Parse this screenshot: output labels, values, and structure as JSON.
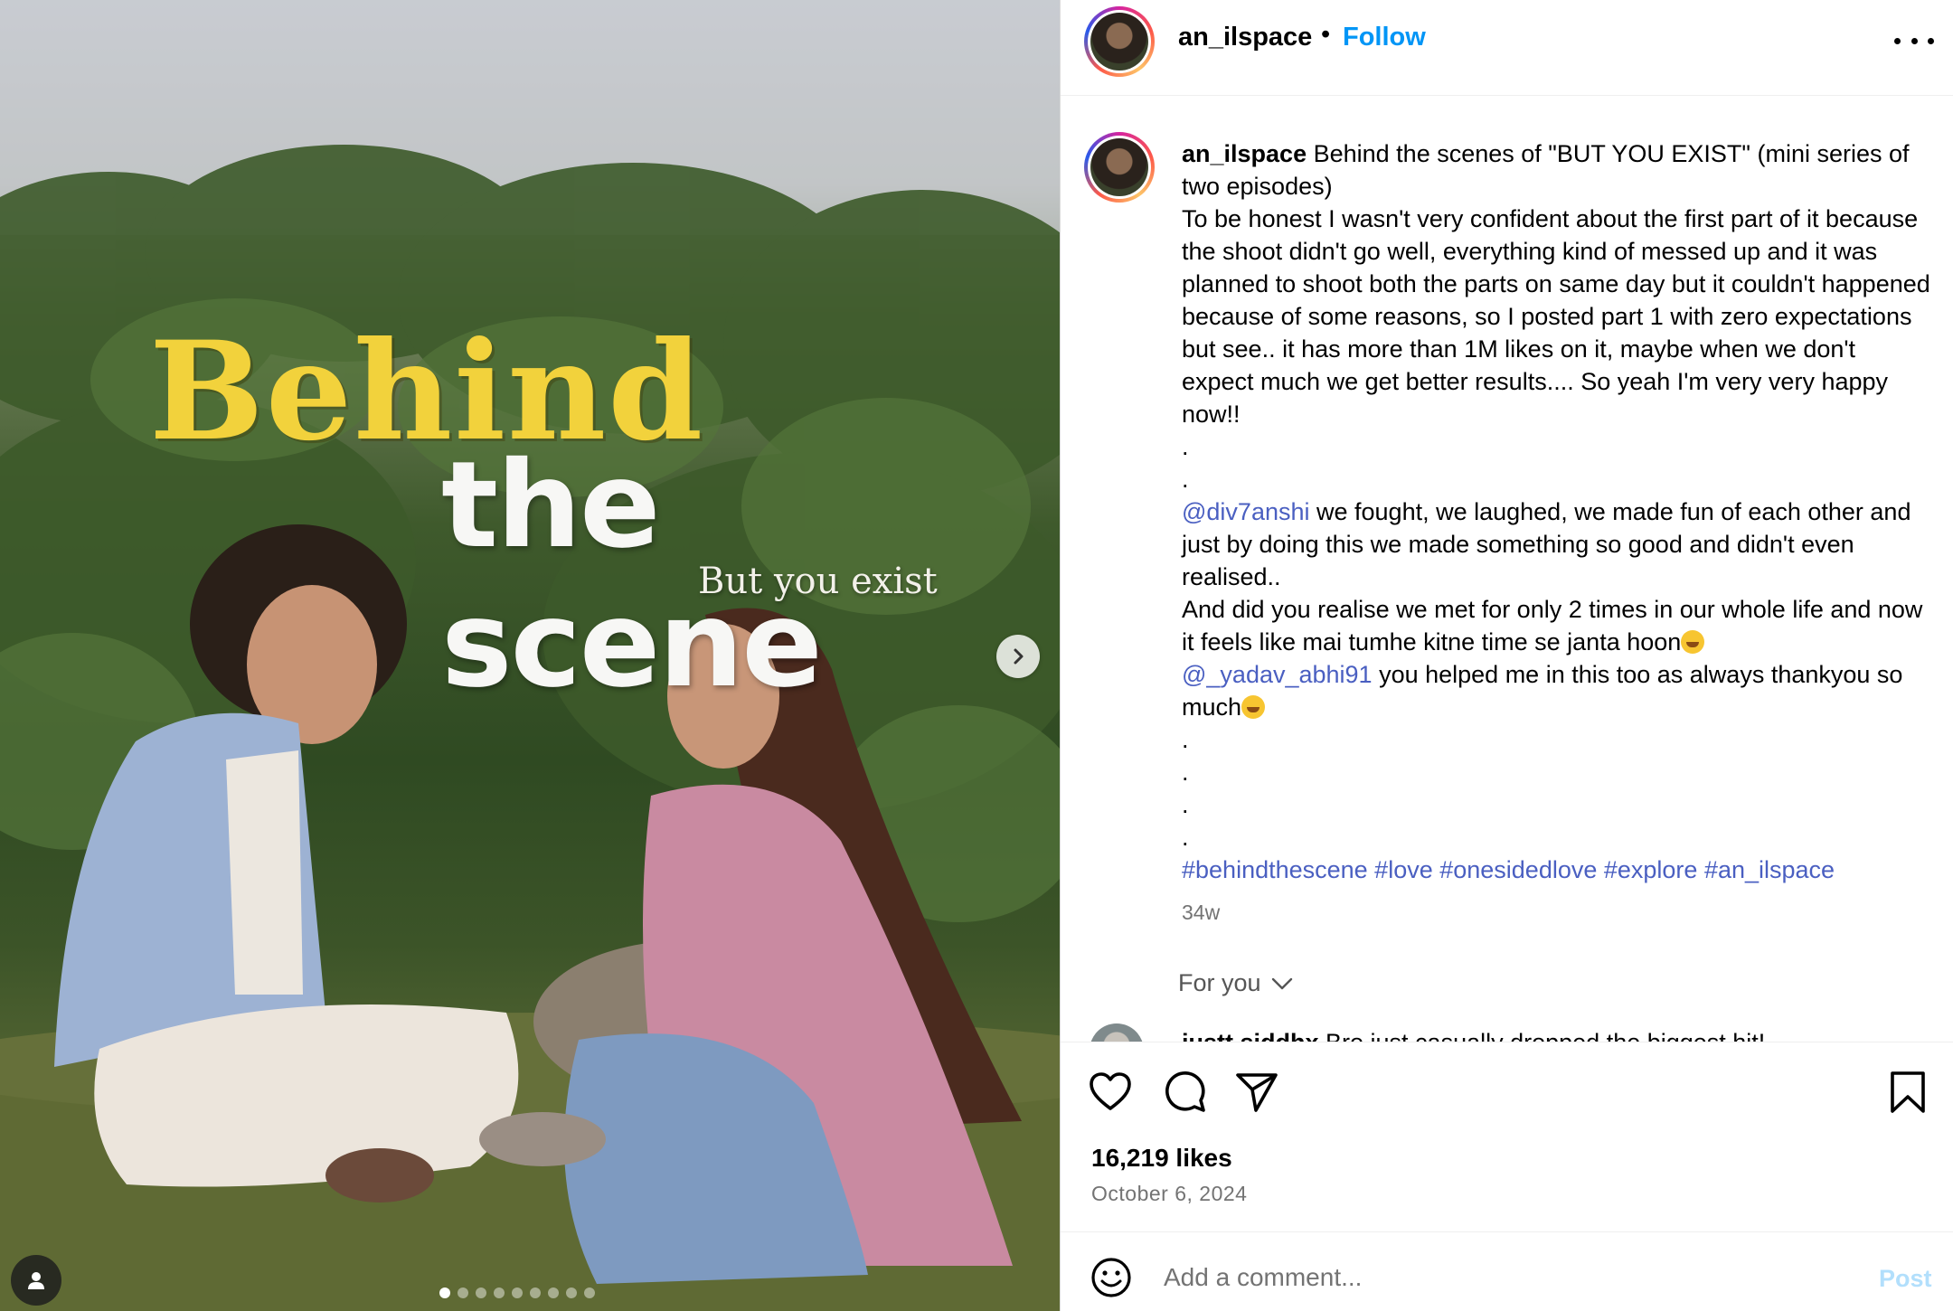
{
  "post": {
    "username": "an_ilspace",
    "separator": "•",
    "follow_label": "Follow",
    "more_icon": "more-horizontal-icon"
  },
  "media": {
    "overlay_title": "Behind",
    "overlay_subtitle": "the scene",
    "overlay_tagline": "But you exist",
    "next_icon": "chevron-right-icon",
    "tag_icon": "user-tag-icon",
    "slide_count": 9,
    "active_slide": 1
  },
  "caption": {
    "username": "an_ilspace",
    "line1": "Behind the scenes of \"BUT YOU EXIST\" (mini series of two episodes)",
    "body": "To be honest I wasn't very confident about the first part of it because the shoot didn't go well, everything kind of messed up and it was planned to shoot both the parts on same day but it couldn't happened because of some reasons, so I posted part 1 with zero expectations but see.. it has more than 1M likes on it, maybe when we don't expect much we get better results.... So yeah I'm very very happy now!!",
    "dot": ".",
    "mention1": "@div7anshi",
    "mention1_text": " we fought, we laughed, we made fun of each other and just by doing this we made something so good and didn't even realised..",
    "line_met": "And did you realise we met for only 2 times in our whole life and now it feels like mai tumhe kitne time se janta hoon",
    "mention2": "@_yadav_abhi91",
    "mention2_text": " you helped me in this too as always thankyou so much",
    "hashtags": "#behindthescene #love #onesidedlove #explore #an_ilspace",
    "time_ago": "34w"
  },
  "comments": {
    "filter_label": "For you",
    "peek_username": "justt.siddhx",
    "peek_text": " Bro just casually dropped the biggest hit!"
  },
  "actions": {
    "like_icon": "heart-icon",
    "comment_icon": "comment-icon",
    "share_icon": "send-icon",
    "save_icon": "bookmark-icon",
    "likes": "16,219 likes",
    "date": "October 6, 2024"
  },
  "composer": {
    "placeholder": "Add a comment...",
    "emoji_icon": "smile-icon",
    "post_label": "Post",
    "post_color": "#b2dffc"
  },
  "colors": {
    "link": "#0095f6",
    "mention": "#4a5fc1",
    "muted": "#737373",
    "overlay_yellow": "#f2d23c"
  }
}
